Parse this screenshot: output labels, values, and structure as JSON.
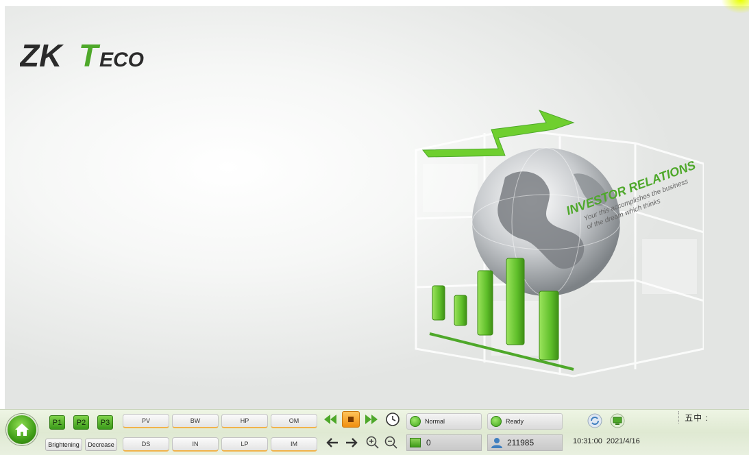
{
  "logo": {
    "text_zk": "ZK",
    "text_t": "T",
    "text_eco": "ECO"
  },
  "illustration": {
    "banner_title": "INVESTOR RELATIONS",
    "banner_line1": "Your this accomplishes the business",
    "banner_line2": "of the dream which thinks"
  },
  "toolbar": {
    "presets": [
      "P1",
      "P2",
      "P3"
    ],
    "brightening_label": "Brightening",
    "decrease_label": "Decrease",
    "modes_top": [
      "PV",
      "BW",
      "HP",
      "OM"
    ],
    "modes_bottom": [
      "DS",
      "IN",
      "LP",
      "IM"
    ],
    "status_mode": "Normal",
    "status_state": "Ready",
    "count_value": "0",
    "user_value": "211985",
    "time": "10:31:00",
    "date": "2021/4/16",
    "ime_text": "五中 :"
  },
  "colors": {
    "accent_green": "#4ea82a",
    "accent_orange": "#f2a21e",
    "toolbar_bg": "#e4ecd8"
  }
}
